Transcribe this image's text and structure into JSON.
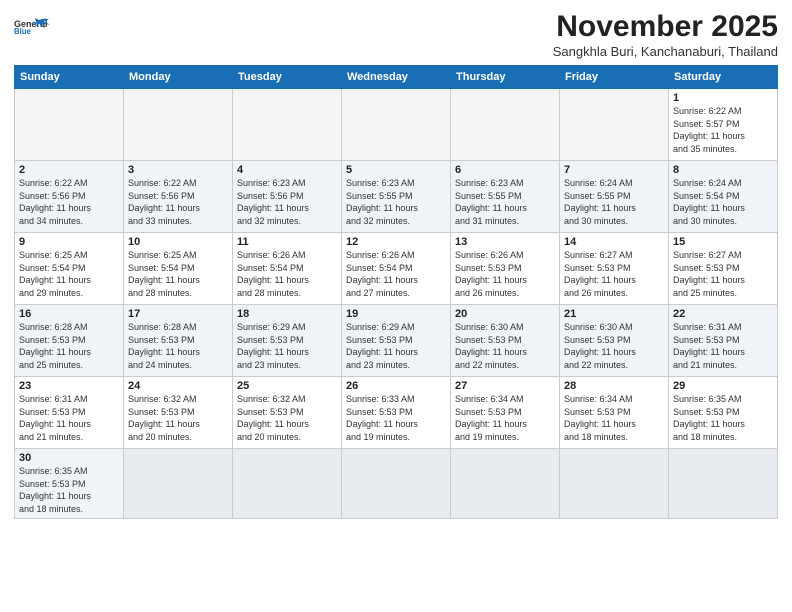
{
  "header": {
    "logo_line1": "General",
    "logo_line2": "Blue",
    "month_title": "November 2025",
    "subtitle": "Sangkhla Buri, Kanchanaburi, Thailand"
  },
  "weekdays": [
    "Sunday",
    "Monday",
    "Tuesday",
    "Wednesday",
    "Thursday",
    "Friday",
    "Saturday"
  ],
  "weeks": [
    [
      {
        "day": "",
        "info": ""
      },
      {
        "day": "",
        "info": ""
      },
      {
        "day": "",
        "info": ""
      },
      {
        "day": "",
        "info": ""
      },
      {
        "day": "",
        "info": ""
      },
      {
        "day": "",
        "info": ""
      },
      {
        "day": "1",
        "info": "Sunrise: 6:22 AM\nSunset: 5:57 PM\nDaylight: 11 hours\nand 35 minutes."
      }
    ],
    [
      {
        "day": "2",
        "info": "Sunrise: 6:22 AM\nSunset: 5:56 PM\nDaylight: 11 hours\nand 34 minutes."
      },
      {
        "day": "3",
        "info": "Sunrise: 6:22 AM\nSunset: 5:56 PM\nDaylight: 11 hours\nand 33 minutes."
      },
      {
        "day": "4",
        "info": "Sunrise: 6:23 AM\nSunset: 5:56 PM\nDaylight: 11 hours\nand 32 minutes."
      },
      {
        "day": "5",
        "info": "Sunrise: 6:23 AM\nSunset: 5:55 PM\nDaylight: 11 hours\nand 32 minutes."
      },
      {
        "day": "6",
        "info": "Sunrise: 6:23 AM\nSunset: 5:55 PM\nDaylight: 11 hours\nand 31 minutes."
      },
      {
        "day": "7",
        "info": "Sunrise: 6:24 AM\nSunset: 5:55 PM\nDaylight: 11 hours\nand 30 minutes."
      },
      {
        "day": "8",
        "info": "Sunrise: 6:24 AM\nSunset: 5:54 PM\nDaylight: 11 hours\nand 30 minutes."
      }
    ],
    [
      {
        "day": "9",
        "info": "Sunrise: 6:25 AM\nSunset: 5:54 PM\nDaylight: 11 hours\nand 29 minutes."
      },
      {
        "day": "10",
        "info": "Sunrise: 6:25 AM\nSunset: 5:54 PM\nDaylight: 11 hours\nand 28 minutes."
      },
      {
        "day": "11",
        "info": "Sunrise: 6:26 AM\nSunset: 5:54 PM\nDaylight: 11 hours\nand 28 minutes."
      },
      {
        "day": "12",
        "info": "Sunrise: 6:26 AM\nSunset: 5:54 PM\nDaylight: 11 hours\nand 27 minutes."
      },
      {
        "day": "13",
        "info": "Sunrise: 6:26 AM\nSunset: 5:53 PM\nDaylight: 11 hours\nand 26 minutes."
      },
      {
        "day": "14",
        "info": "Sunrise: 6:27 AM\nSunset: 5:53 PM\nDaylight: 11 hours\nand 26 minutes."
      },
      {
        "day": "15",
        "info": "Sunrise: 6:27 AM\nSunset: 5:53 PM\nDaylight: 11 hours\nand 25 minutes."
      }
    ],
    [
      {
        "day": "16",
        "info": "Sunrise: 6:28 AM\nSunset: 5:53 PM\nDaylight: 11 hours\nand 25 minutes."
      },
      {
        "day": "17",
        "info": "Sunrise: 6:28 AM\nSunset: 5:53 PM\nDaylight: 11 hours\nand 24 minutes."
      },
      {
        "day": "18",
        "info": "Sunrise: 6:29 AM\nSunset: 5:53 PM\nDaylight: 11 hours\nand 23 minutes."
      },
      {
        "day": "19",
        "info": "Sunrise: 6:29 AM\nSunset: 5:53 PM\nDaylight: 11 hours\nand 23 minutes."
      },
      {
        "day": "20",
        "info": "Sunrise: 6:30 AM\nSunset: 5:53 PM\nDaylight: 11 hours\nand 22 minutes."
      },
      {
        "day": "21",
        "info": "Sunrise: 6:30 AM\nSunset: 5:53 PM\nDaylight: 11 hours\nand 22 minutes."
      },
      {
        "day": "22",
        "info": "Sunrise: 6:31 AM\nSunset: 5:53 PM\nDaylight: 11 hours\nand 21 minutes."
      }
    ],
    [
      {
        "day": "23",
        "info": "Sunrise: 6:31 AM\nSunset: 5:53 PM\nDaylight: 11 hours\nand 21 minutes."
      },
      {
        "day": "24",
        "info": "Sunrise: 6:32 AM\nSunset: 5:53 PM\nDaylight: 11 hours\nand 20 minutes."
      },
      {
        "day": "25",
        "info": "Sunrise: 6:32 AM\nSunset: 5:53 PM\nDaylight: 11 hours\nand 20 minutes."
      },
      {
        "day": "26",
        "info": "Sunrise: 6:33 AM\nSunset: 5:53 PM\nDaylight: 11 hours\nand 19 minutes."
      },
      {
        "day": "27",
        "info": "Sunrise: 6:34 AM\nSunset: 5:53 PM\nDaylight: 11 hours\nand 19 minutes."
      },
      {
        "day": "28",
        "info": "Sunrise: 6:34 AM\nSunset: 5:53 PM\nDaylight: 11 hours\nand 18 minutes."
      },
      {
        "day": "29",
        "info": "Sunrise: 6:35 AM\nSunset: 5:53 PM\nDaylight: 11 hours\nand 18 minutes."
      }
    ],
    [
      {
        "day": "30",
        "info": "Sunrise: 6:35 AM\nSunset: 5:53 PM\nDaylight: 11 hours\nand 18 minutes."
      },
      {
        "day": "",
        "info": ""
      },
      {
        "day": "",
        "info": ""
      },
      {
        "day": "",
        "info": ""
      },
      {
        "day": "",
        "info": ""
      },
      {
        "day": "",
        "info": ""
      },
      {
        "day": "",
        "info": ""
      }
    ]
  ]
}
